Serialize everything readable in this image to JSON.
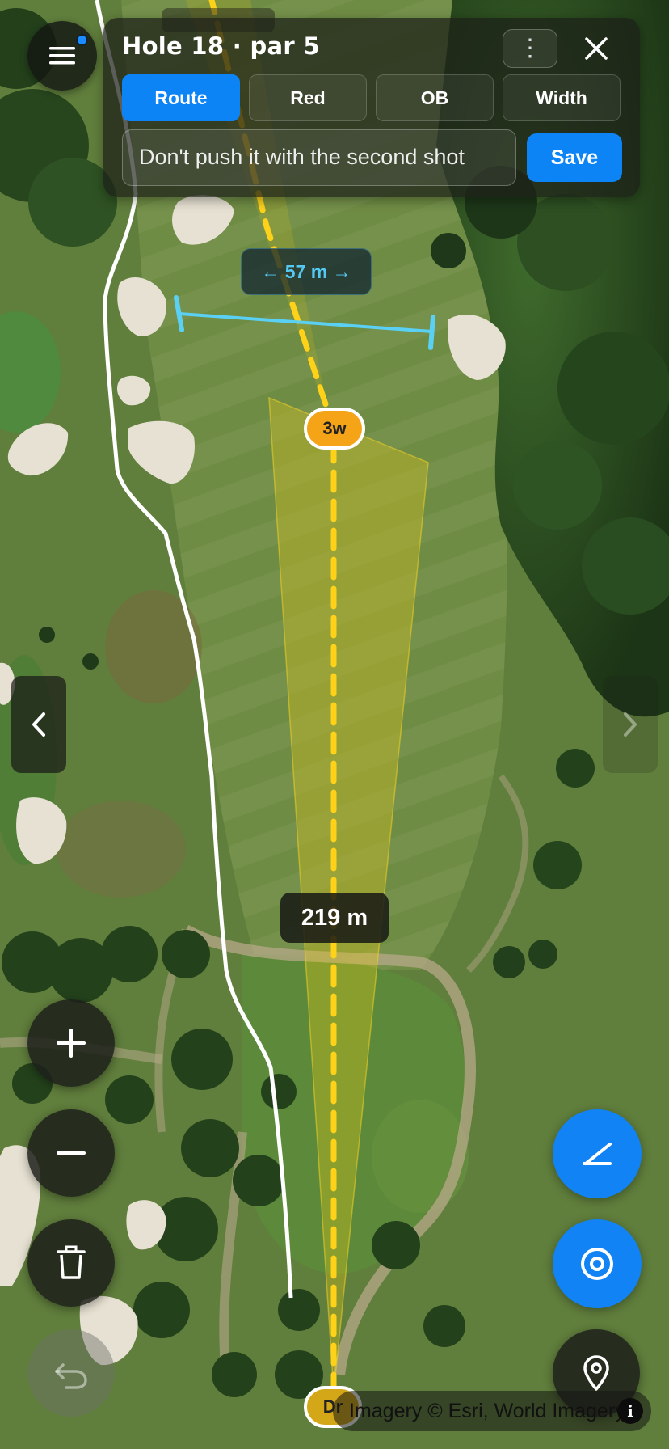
{
  "header": {
    "title": "Hole 18 · par 5",
    "more_icon": "more-vertical-icon",
    "close_icon": "close-icon"
  },
  "modes": [
    {
      "label": "Route",
      "active": true
    },
    {
      "label": "Red",
      "active": false
    },
    {
      "label": "OB",
      "active": false
    },
    {
      "label": "Width",
      "active": false
    }
  ],
  "note": {
    "value": "Don't push it with the second shot",
    "save_label": "Save"
  },
  "map": {
    "fairway_width_label": "← 57 m →",
    "shot_distance_label": "219 m",
    "start_club": "Dr",
    "target_club": "3w"
  },
  "attribution": {
    "text": "Imagery © Esri, World Imagery",
    "info": "i"
  },
  "controls": {
    "menu_icon": "hamburger-menu-icon",
    "prev_icon": "chevron-left-icon",
    "next_icon": "chevron-right-icon",
    "zoom_in_icon": "plus-icon",
    "zoom_out_icon": "minus-icon",
    "delete_icon": "trash-icon",
    "undo_icon": "undo-icon",
    "draw_icon": "pen-icon",
    "target_icon": "target-icon",
    "location_icon": "location-pin-icon"
  },
  "colors": {
    "accent": "#0d84f6",
    "route_line": "#ffd21a",
    "width_line": "#5ad0f5",
    "club_badge": "#f5a417",
    "ob_line": "#ffffff"
  }
}
